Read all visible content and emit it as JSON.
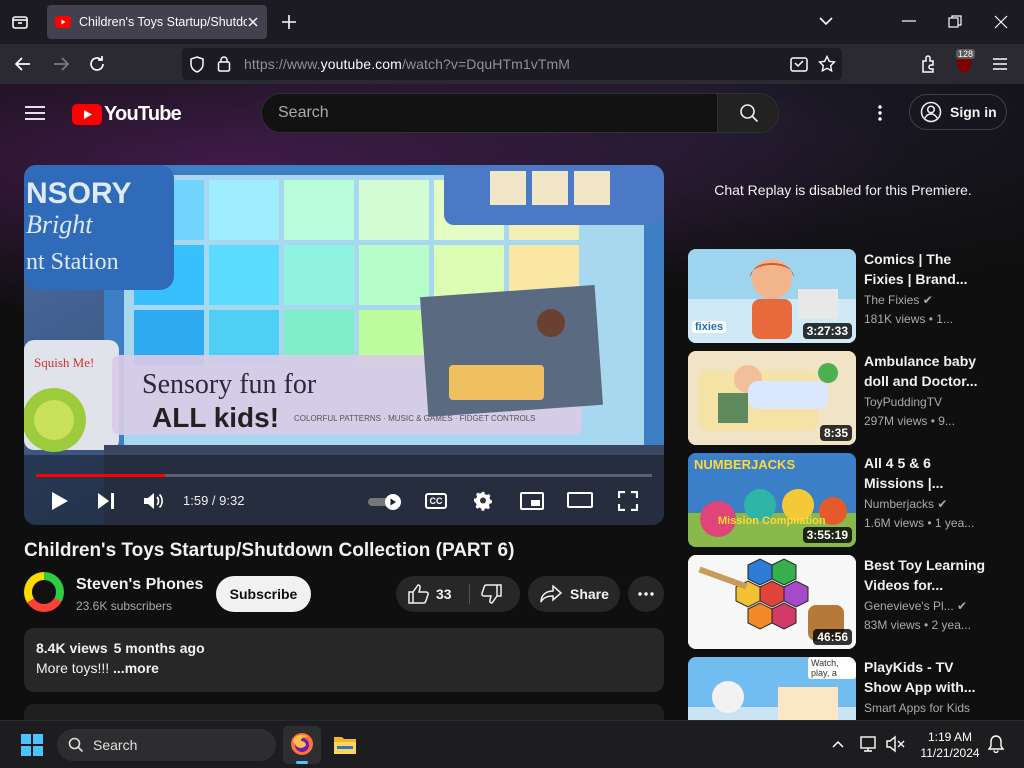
{
  "browser": {
    "tab_title": "Children's Toys Startup/Shutdown",
    "url_prefix": "https://www.",
    "url_domain": "youtube.com",
    "url_path": "/watch?v=DquHTm1vTmM",
    "extension_badge": "128"
  },
  "youtube": {
    "logo_text": "YouTube",
    "search_placeholder": "Search",
    "sign_in_label": "Sign in"
  },
  "player": {
    "time_current": "1:59",
    "time_separator": " / ",
    "time_total": "9:32",
    "progress": 0.21,
    "cc_label": "CC",
    "video_text_1": "Sensory fun for",
    "video_text_2": "ALL kids!",
    "video_text_3": "COLORFUL PATTERNS  ·  MUSIC & GAMES  ·  FIDGET CONTROLS",
    "video_sign_1": "NSORY",
    "video_sign_2": "Bright",
    "video_sign_3": "nt Station",
    "video_sign_4": "Squish Me!"
  },
  "video": {
    "title": "Children's Toys Startup/Shutdown Collection (PART 6)",
    "channel": "Steven's Phones",
    "subscribers": "23.6K subscribers",
    "subscribe_label": "Subscribe",
    "likes": "33",
    "share_label": "Share",
    "views": "8.4K views",
    "age": "5 months ago",
    "description": "More toys!!!",
    "more_label": "...more"
  },
  "sidebar": {
    "chat_notice": "Chat Replay is disabled for this Premiere.",
    "recommendations": [
      {
        "title": "Comics | The Fixies | Brand...",
        "channel": "The Fixies",
        "verified": true,
        "meta": "181K views  • 1...",
        "duration": "3:27:33",
        "thumb_label": "fixies"
      },
      {
        "title": "Ambulance baby doll and Doctor...",
        "channel": "ToyPuddingTV",
        "verified": false,
        "meta": "297M views  • 9...",
        "duration": "8:35",
        "thumb_label": ""
      },
      {
        "title": "All 4 5 & 6 Missions |...",
        "channel": "Numberjacks",
        "verified": true,
        "meta": "1.6M views  • 1 yea...",
        "duration": "3:55:19",
        "thumb_label": "NUMBERJACKS",
        "thumb_label_2": "Mission Compilation"
      },
      {
        "title": "Best Toy Learning Videos for...",
        "channel": "Genevieve's Pl...",
        "verified": true,
        "meta": "83M views  • 2 yea...",
        "duration": "46:56",
        "thumb_label": ""
      },
      {
        "title": "PlayKids - TV Show App with...",
        "channel": "Smart Apps for Kids",
        "verified": false,
        "meta": "",
        "duration": "",
        "thumb_label": "Watch, play, a"
      }
    ]
  },
  "taskbar": {
    "search_label": "Search",
    "time": "1:19 AM",
    "date": "11/21/2024"
  },
  "colors": {
    "youtube_red": "#ff0000",
    "progress_red": "#f00",
    "page_bg": "#0f0f0f",
    "chrome_bg": "#2b2a33"
  }
}
